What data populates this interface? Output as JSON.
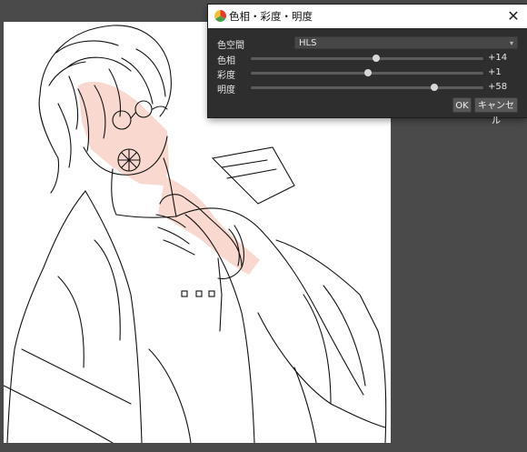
{
  "dialog": {
    "title": "色相・彩度・明度",
    "close_glyph": "✕",
    "colorspace": {
      "label": "色空間",
      "value": "HLS"
    },
    "sliders": [
      {
        "label": "色相",
        "value_text": "+14",
        "value": 14,
        "min": -180,
        "max": 180
      },
      {
        "label": "彩度",
        "value_text": "+1",
        "value": 1,
        "min": -100,
        "max": 100
      },
      {
        "label": "明度",
        "value_text": "+58",
        "value": 58,
        "min": -100,
        "max": 100
      }
    ],
    "ok_label": "OK",
    "cancel_label": "キャンセル"
  },
  "colors": {
    "workspace": "#4a4a4a",
    "paper": "#ffffff",
    "dialog_bg": "#2e2e2e",
    "skin_tint": "#f9d9cf"
  },
  "icons": [
    "color-wheel-icon",
    "close-icon",
    "dropdown-arrow-icon"
  ]
}
